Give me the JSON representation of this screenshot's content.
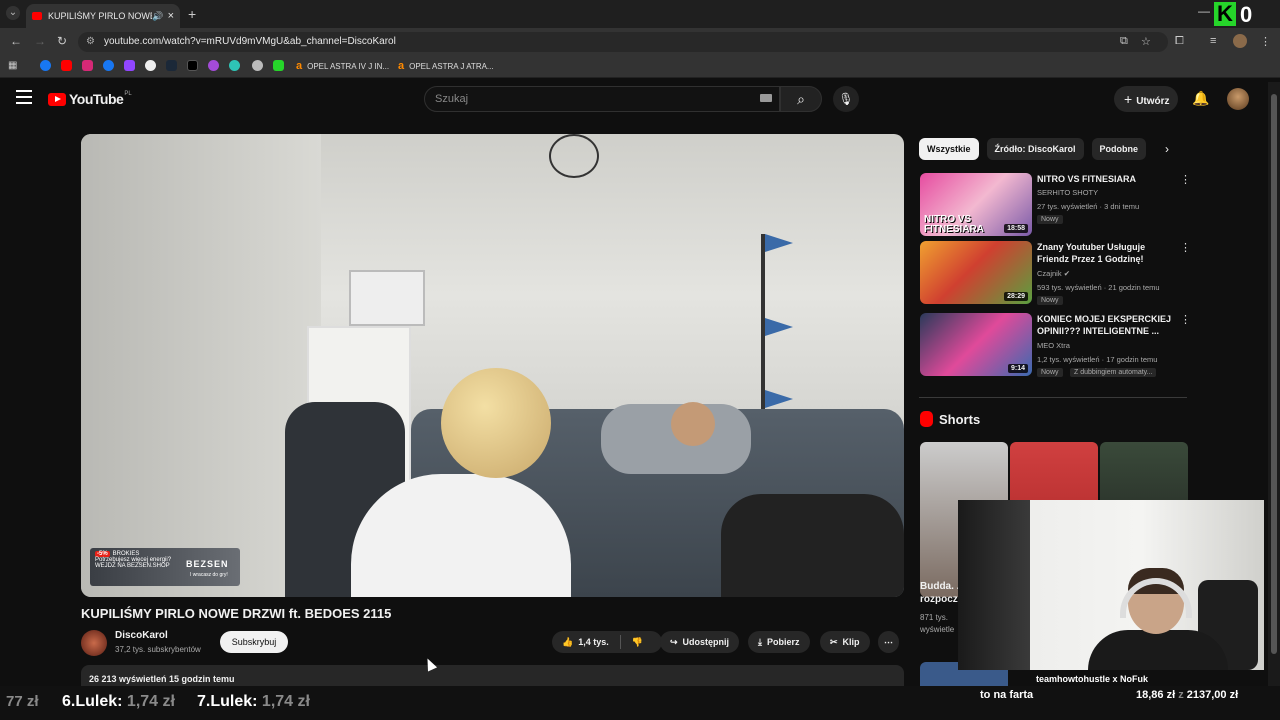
{
  "browser": {
    "tab_title": "KUPILIŚMY PIRLO NOWE D",
    "url": "youtube.com/watch?v=mRUVd9mVMgU&ab_channel=DiscoKarol",
    "bookmarks": [
      {
        "label": "OPEL ASTRA IV J IN..."
      },
      {
        "label": "OPEL ASTRA J ATRA..."
      }
    ],
    "overlay_badge": "0"
  },
  "header": {
    "logo_text": "YouTube",
    "region": "PL",
    "search_placeholder": "Szukaj",
    "create_label": "Utwórz"
  },
  "video": {
    "title": "KUPILIŚMY PIRLO NOWE DRZWI ft. BEDOES 2115",
    "channel": "DiscoKarol",
    "subscribers": "37,2 tys. subskrybentów",
    "subscribe_label": "Subskrybuj",
    "likes": "1,4 tys.",
    "share_label": "Udostępnij",
    "download_label": "Pobierz",
    "clip_label": "Klip",
    "views_line": "26 213 wyświetleń  15 godzin temu",
    "ad": {
      "pct": "-5%",
      "tag": "BROKIES",
      "line1": "Potrzebujesz więcej energii?",
      "line2": "WEJDŹ NA BEZSEN.SHOP",
      "brand": "BEZSEN",
      "sub": "I wracasz do gry!"
    }
  },
  "chips": [
    "Wszystkie",
    "Źródło: DiscoKarol",
    "Podobne"
  ],
  "recommendations": [
    {
      "title": "NITRO VS FITNESIARA",
      "channel": "SERHITO SHOTY",
      "meta": "27 tys. wyświetleń · 3 dni temu",
      "badge": "Nowy",
      "duration": "18:58",
      "thumb_text": "NITRO VS FITNESIARA",
      "color": "#e64ca0"
    },
    {
      "title": "Znany Youtuber Usługuje Friendz Przez 1 Godzinę!",
      "channel": "Czajnik",
      "meta": "593 tys. wyświetleń · 21 godzin temu",
      "badge": "Nowy",
      "duration": "28:29",
      "thumb_text": "",
      "color": "#c43a2a"
    },
    {
      "title": "KONIEC MOJEJ EKSPERCKIEJ OPINII??? INTELIGENTNE ...",
      "channel": "MEO Xtra",
      "meta": "1,2 tys. wyświetleń · 17 godzin temu",
      "badge": "Nowy",
      "badge2": "Z dubbingiem automaty...",
      "duration": "9:14",
      "thumb_text": "",
      "color": "#4a7ac4"
    }
  ],
  "shorts": {
    "heading": "Shorts",
    "first_title": "Budda. ... rozpocz...",
    "first_title_l1": "Budda. .",
    "first_title_l2": "rozpocz",
    "first_views_l1": "871 tys.",
    "first_views_l2": "wyświetle"
  },
  "overlay": {
    "webcam_label": "teamhowtohustle x NoFuk"
  },
  "ticker": {
    "left_amount": "77 zł",
    "item1_name": "6.Lulek:",
    "item1_amount": "1,74 zł",
    "item2_name": "7.Lulek:",
    "item2_amount": "1,74 zł",
    "center": "to na farta",
    "right1": "18,86 zł",
    "right_sep": "z",
    "right2": "2137,00 zł"
  },
  "colors": {
    "accent": "#ff0000",
    "background": "#0f0f0f",
    "chip_active": "#f1f1f1",
    "green_badge": "#26d52a"
  }
}
